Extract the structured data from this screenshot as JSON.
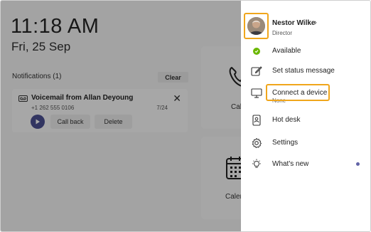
{
  "home": {
    "time": "11:18 AM",
    "date": "Fri, 25 Sep",
    "notifications_title": "Notifications (1)",
    "clear_label": "Clear"
  },
  "voicemail": {
    "title": "Voicemail from Allan Deyoung",
    "number": "+1 262 555 0106",
    "date": "7/24",
    "callback_label": "Call back",
    "delete_label": "Delete",
    "icons": {
      "voicemail": "voicemail-icon",
      "close": "close-icon",
      "play": "play-icon"
    }
  },
  "tiles": {
    "calls_label": "Cal",
    "calendar_label": "Caler"
  },
  "profile": {
    "name": "Nestor Wilke",
    "role": "Director",
    "chevron": "›"
  },
  "menu": {
    "available": "Available",
    "set_status": "Set status message",
    "connect_device": "Connect a device",
    "connect_sub": "None",
    "hot_desk": "Hot desk",
    "settings": "Settings",
    "whats_new": "What's new"
  },
  "colors": {
    "highlight": "#f0a61c",
    "available": "#6bb700",
    "brand": "#6264a7",
    "play": "#4b4f91"
  }
}
